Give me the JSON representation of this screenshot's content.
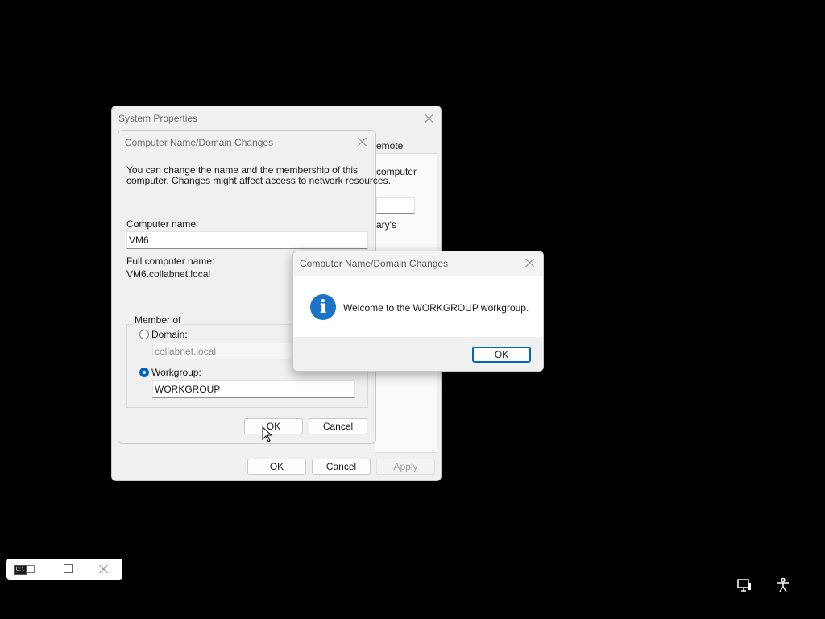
{
  "system_properties": {
    "title": "System Properties",
    "tab_partial": "emote",
    "partial_line1": "computer",
    "partial_line2": "ary's",
    "ok_label": "OK",
    "cancel_label": "Cancel",
    "apply_label": "Apply"
  },
  "name_dialog": {
    "title": "Computer Name/Domain Changes",
    "intro_line1": "You can change the name and the membership of this",
    "intro_line2": "computer. Changes might affect access to network resources.",
    "computer_name_label": "Computer name:",
    "computer_name_value": "VM6",
    "full_name_label": "Full computer name:",
    "full_name_value": "VM6.collabnet.local",
    "member_of_label": "Member of",
    "domain_label": "Domain:",
    "domain_value": "collabnet.local",
    "workgroup_label": "Workgroup:",
    "workgroup_value": "WORKGROUP",
    "ok_label": "OK",
    "cancel_label": "Cancel"
  },
  "message_box": {
    "title": "Computer Name/Domain Changes",
    "message": "Welcome to the WORKGROUP workgroup.",
    "ok_label": "OK",
    "icon": "info-icon"
  },
  "taskbar": {
    "icons": [
      "console-icon",
      "restore-icon",
      "maximize-icon",
      "close-icon"
    ],
    "tray_icons": [
      "network-display-icon",
      "accessibility-icon"
    ]
  },
  "colors": {
    "accent": "#0067c0",
    "desktop": "#000000",
    "dialog_bg": "#f0f0f0",
    "info_icon": "#1a74c8"
  }
}
